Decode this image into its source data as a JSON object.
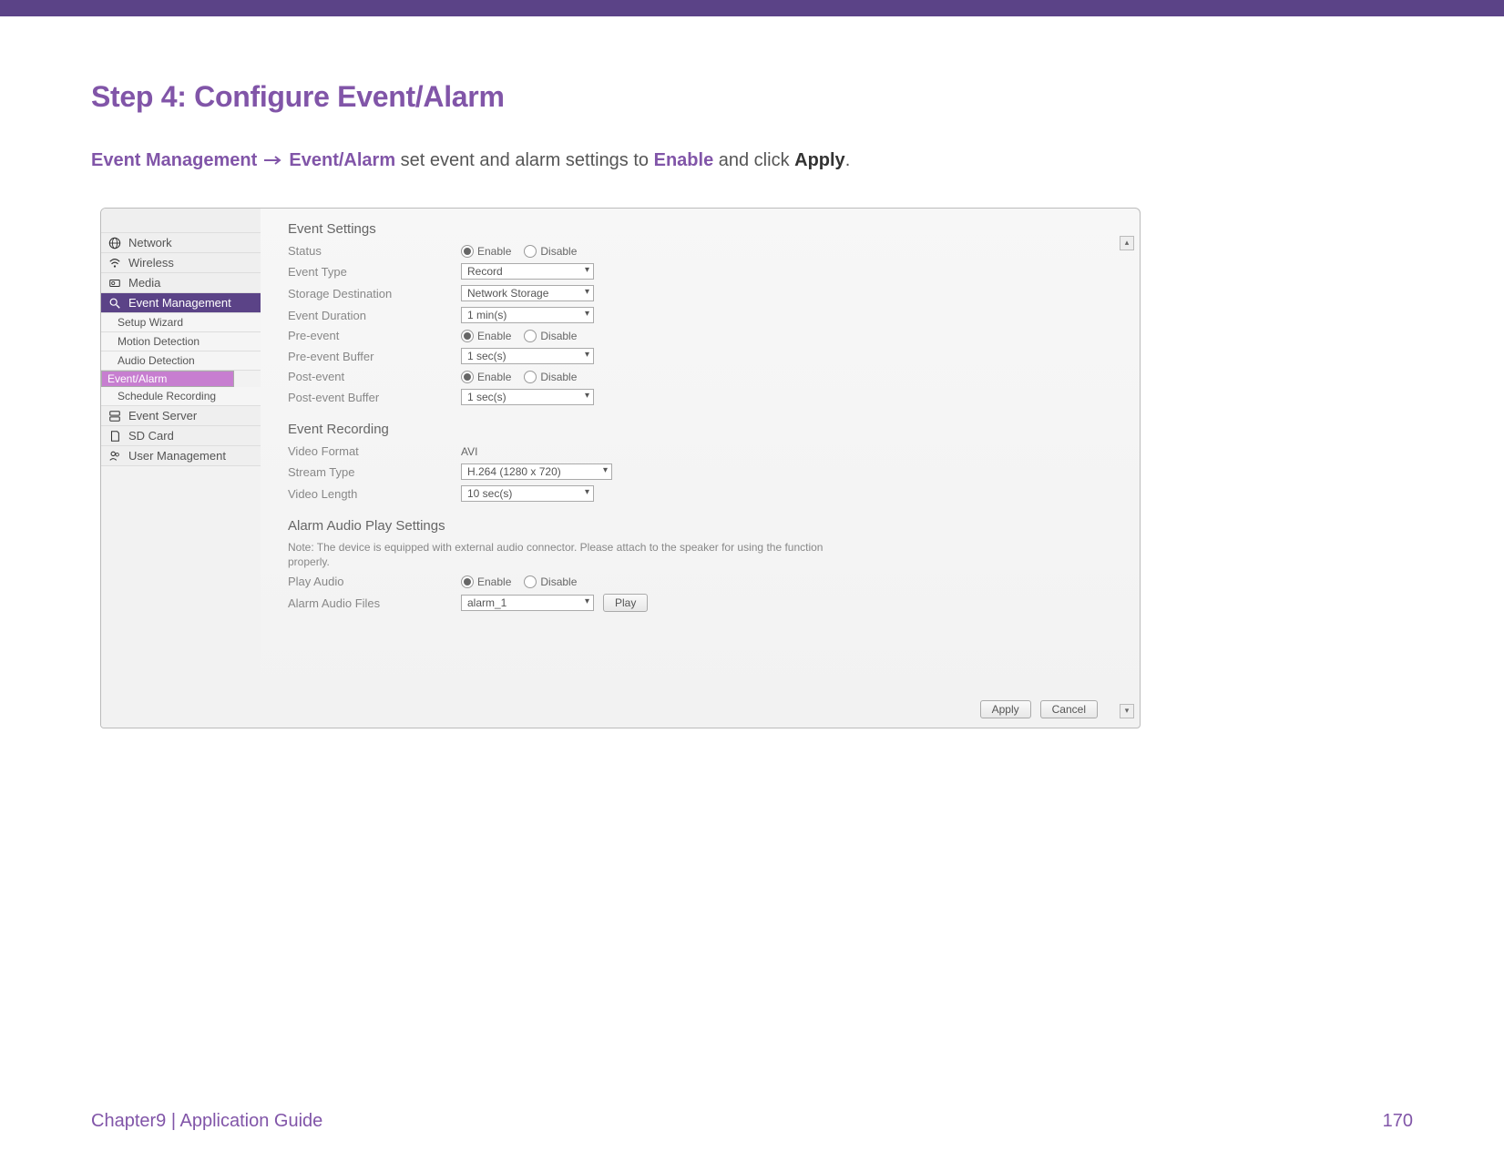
{
  "heading": "Step 4: Configure Event/Alarm",
  "instruction": {
    "part1": "Event Management",
    "part2": "Event/Alarm",
    "part3": " set event and alarm settings to ",
    "part4": "Enable",
    "part5": " and click ",
    "part6": "Apply",
    "part7": "."
  },
  "sidebar": [
    "Network",
    "Wireless",
    "Media",
    "Event Management",
    "Event Server",
    "SD Card",
    "User Management"
  ],
  "sidebar_sub": [
    "Setup Wizard",
    "Motion Detection",
    "Audio Detection",
    "Event/Alarm",
    "Schedule Recording"
  ],
  "panel": {
    "sec1": "Event Settings",
    "sec2": "Event Recording",
    "sec3": "Alarm Audio Play Settings",
    "enable": "Enable",
    "disable": "Disable",
    "rows": {
      "status": "Status",
      "event_type": "Event Type",
      "storage": "Storage Destination",
      "duration": "Event Duration",
      "pre_event": "Pre-event",
      "pre_buf": "Pre-event Buffer",
      "post_event": "Post-event",
      "post_buf": "Post-event Buffer",
      "video_format": "Video Format",
      "stream_type": "Stream Type",
      "video_length": "Video Length",
      "play_audio": "Play Audio",
      "audio_files": "Alarm Audio Files"
    },
    "vals": {
      "event_type": "Record",
      "storage": "Network Storage",
      "duration": "1 min(s)",
      "pre_buf": "1 sec(s)",
      "post_buf": "1 sec(s)",
      "video_format": "AVI",
      "stream_type": "H.264 (1280 x 720)",
      "video_length": "10 sec(s)",
      "audio_files": "alarm_1"
    },
    "note": "Note: The device is equipped with external audio connector. Please attach to the speaker for using the function properly.",
    "play_btn": "Play",
    "apply_btn": "Apply",
    "cancel_btn": "Cancel"
  },
  "footer": {
    "chapter": "Chapter9",
    "divider": "  |  ",
    "guide": "Application Guide",
    "page": "170"
  }
}
